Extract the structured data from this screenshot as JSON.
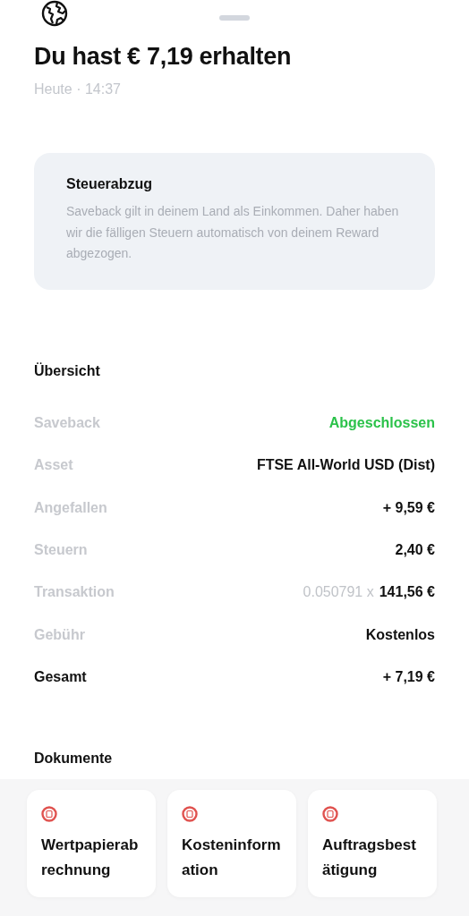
{
  "header": {
    "title": "Du hast € 7,19 erhalten",
    "subtitle": "Heute · 14:37"
  },
  "notice": {
    "title": "Steuerabzug",
    "text": "Saveback gilt in deinem Land als Einkommen. Daher haben wir die fälligen Steuern automatisch von deinem Reward abgezogen."
  },
  "overview": {
    "title": "Übersicht",
    "rows": [
      {
        "kind": "status",
        "label": "Saveback",
        "value": "Abgeschlossen"
      },
      {
        "kind": "plain",
        "label": "Asset",
        "value": "FTSE All-World USD (Dist)"
      },
      {
        "kind": "plain",
        "label": "Angefallen",
        "value": "+ 9,59 €"
      },
      {
        "kind": "plain",
        "label": "Steuern",
        "value": "2,40 €"
      },
      {
        "kind": "transaction",
        "label": "Transaktion",
        "quantity": "0.050791 x",
        "value": "141,56 €"
      },
      {
        "kind": "plain",
        "label": "Gebühr",
        "value": "Kostenlos"
      },
      {
        "kind": "total",
        "label": "Gesamt",
        "value": "+ 7,19 €"
      }
    ]
  },
  "documents": {
    "title": "Dokumente",
    "items": [
      {
        "label": "Wertpapierabrechnung"
      },
      {
        "label": "Kosteninformation"
      },
      {
        "label": "Auftragsbestätigung"
      }
    ]
  }
}
